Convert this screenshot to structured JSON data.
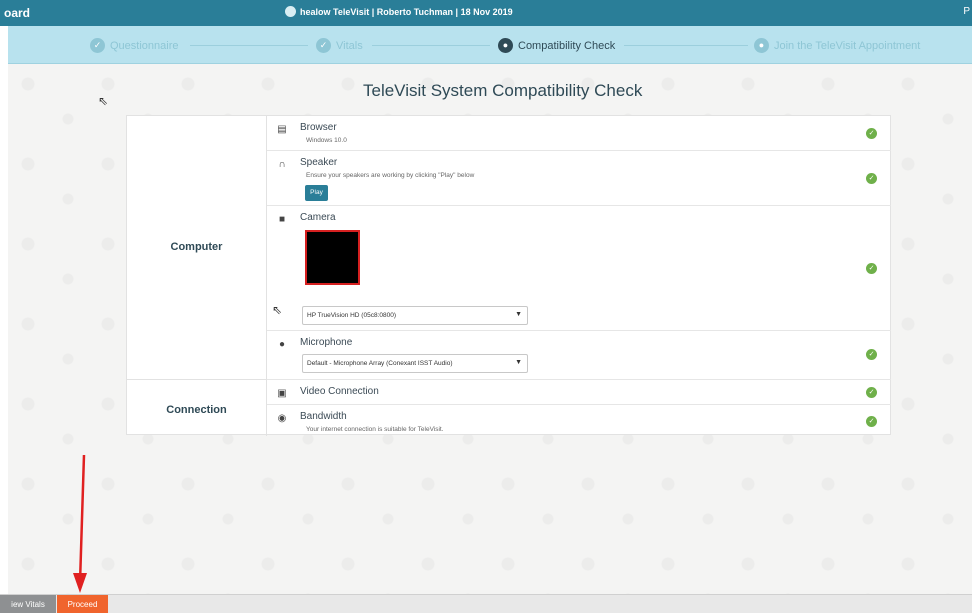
{
  "header": {
    "brand": "oard",
    "center_text": "healow TeleVisit | Roberto Tuchman | 18 Nov 2019",
    "right_text": "P"
  },
  "steps": [
    {
      "label": "Questionnaire",
      "icon": "check-icon"
    },
    {
      "label": "Vitals",
      "icon": "check-icon"
    },
    {
      "label": "Compatibility Check",
      "icon": "car-icon"
    },
    {
      "label": "Join the TeleVisit Appointment",
      "icon": "chat-icon"
    }
  ],
  "main": {
    "title": "TeleVisit System Compatibility Check",
    "categories": {
      "computer": "Computer",
      "connection": "Connection"
    },
    "rows": {
      "browser": {
        "label": "Browser",
        "sub": "Windows 10.0"
      },
      "speaker": {
        "label": "Speaker",
        "sub": "Ensure your speakers are working by clicking \"Play\" below",
        "play_label": "Play"
      },
      "camera": {
        "label": "Camera",
        "select_value": "HP TrueVision HD (05c8:0800)"
      },
      "microphone": {
        "label": "Microphone",
        "select_value": "Default - Microphone Array (Conexant ISST Audio)"
      },
      "video": {
        "label": "Video Connection"
      },
      "bandwidth": {
        "label": "Bandwidth",
        "sub": "Your internet connection is suitable for TeleVisit."
      }
    }
  },
  "footer": {
    "vitals_label": "iew Vitals",
    "proceed_label": "Proceed"
  },
  "colors": {
    "topbar": "#2a7e98",
    "steps_bg": "#b8e2ee",
    "proceed": "#f0642d",
    "ok_green": "#6fb04a",
    "arrow_red": "#e02020"
  }
}
